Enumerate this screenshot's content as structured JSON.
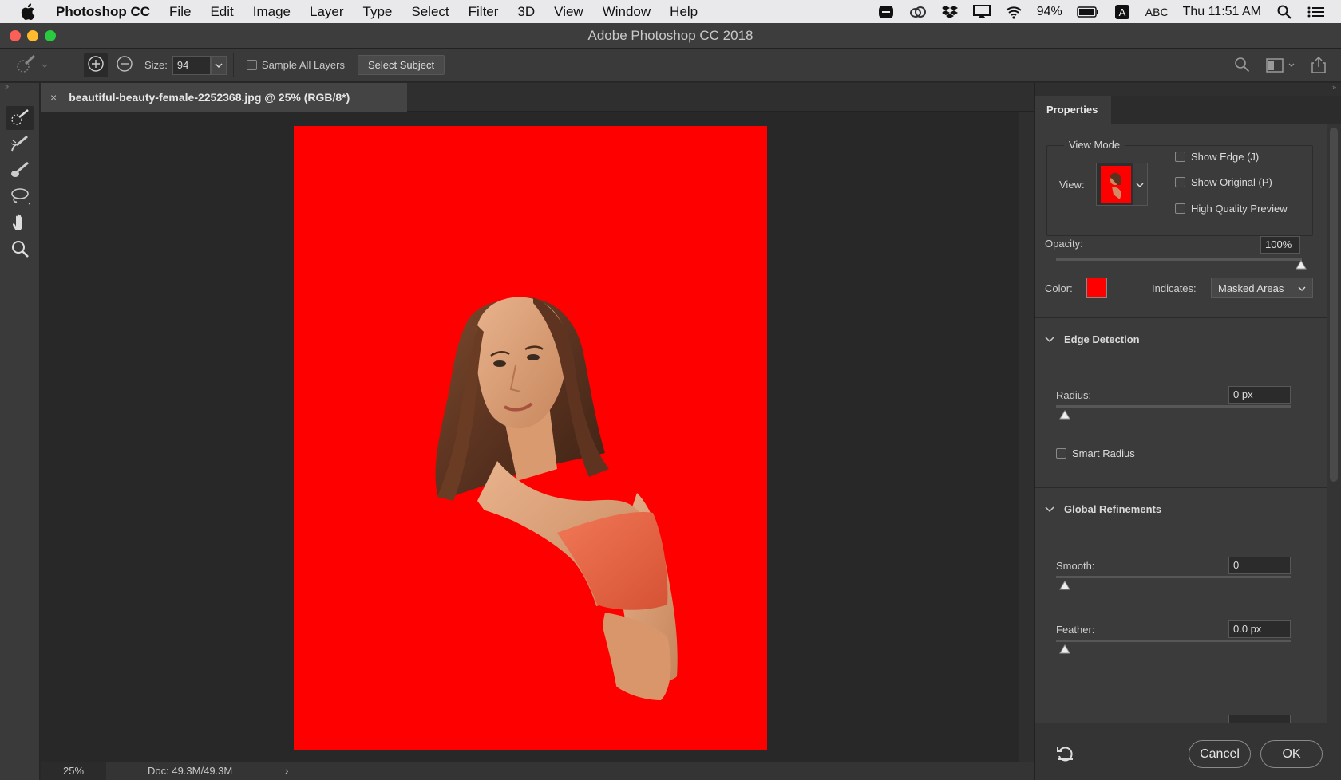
{
  "menubar": {
    "app_name": "Photoshop CC",
    "items": [
      "File",
      "Edit",
      "Image",
      "Layer",
      "Type",
      "Select",
      "Filter",
      "3D",
      "View",
      "Window",
      "Help"
    ],
    "battery": "94%",
    "input_source": "ABC",
    "clock": "Thu 11:51 AM"
  },
  "window": {
    "title": "Adobe Photoshop CC 2018"
  },
  "options": {
    "size_label": "Size:",
    "size_value": "94",
    "sample_all_layers": "Sample All Layers",
    "select_subject": "Select Subject"
  },
  "document": {
    "tab_title": "beautiful-beauty-female-2252368.jpg @ 25% (RGB/8*)",
    "close_glyph": "×",
    "overlay_color": "#fe0000"
  },
  "status": {
    "zoom": "25%",
    "doc_info": "Doc: 49.3M/49.3M",
    "arrow": "›"
  },
  "panel": {
    "tab": "Properties",
    "view_mode": {
      "title": "View Mode",
      "view_label": "View:",
      "show_edge": "Show Edge (J)",
      "show_original": "Show Original (P)",
      "high_quality": "High Quality Preview"
    },
    "opacity_label": "Opacity:",
    "opacity_value": "100%",
    "opacity_level": 1.0,
    "color_label": "Color:",
    "color_value": "#fe0000",
    "indicates_label": "Indicates:",
    "indicates_value": "Masked Areas",
    "edge_detection": {
      "title": "Edge Detection",
      "radius_label": "Radius:",
      "radius_value": "0 px",
      "smart_radius": "Smart Radius"
    },
    "global_refinements": {
      "title": "Global Refinements",
      "smooth_label": "Smooth:",
      "smooth_value": "0",
      "feather_label": "Feather:",
      "feather_value": "0.0 px"
    },
    "cancel": "Cancel",
    "ok": "OK"
  }
}
